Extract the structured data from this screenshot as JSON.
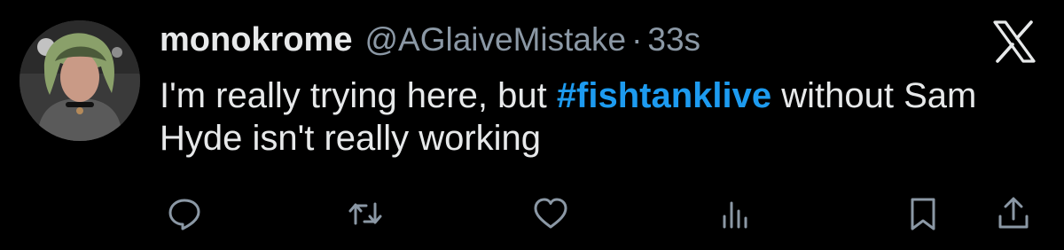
{
  "post": {
    "display_name": "monokrome",
    "handle": "@AGlaiveMistake",
    "separator": "·",
    "time": "33s",
    "text_before": "I'm really trying here, but ",
    "hashtag": "#fishtanklive",
    "text_after": " without Sam Hyde isn't really working"
  },
  "icons": {
    "brand": "x-logo-icon",
    "actions": [
      "reply-icon",
      "repost-icon",
      "like-icon",
      "views-icon",
      "bookmark-icon",
      "share-icon"
    ]
  },
  "colors": {
    "background": "#000000",
    "text": "#e7e9ea",
    "muted": "#8b98a5",
    "hashtag": "#1d9bf0"
  }
}
